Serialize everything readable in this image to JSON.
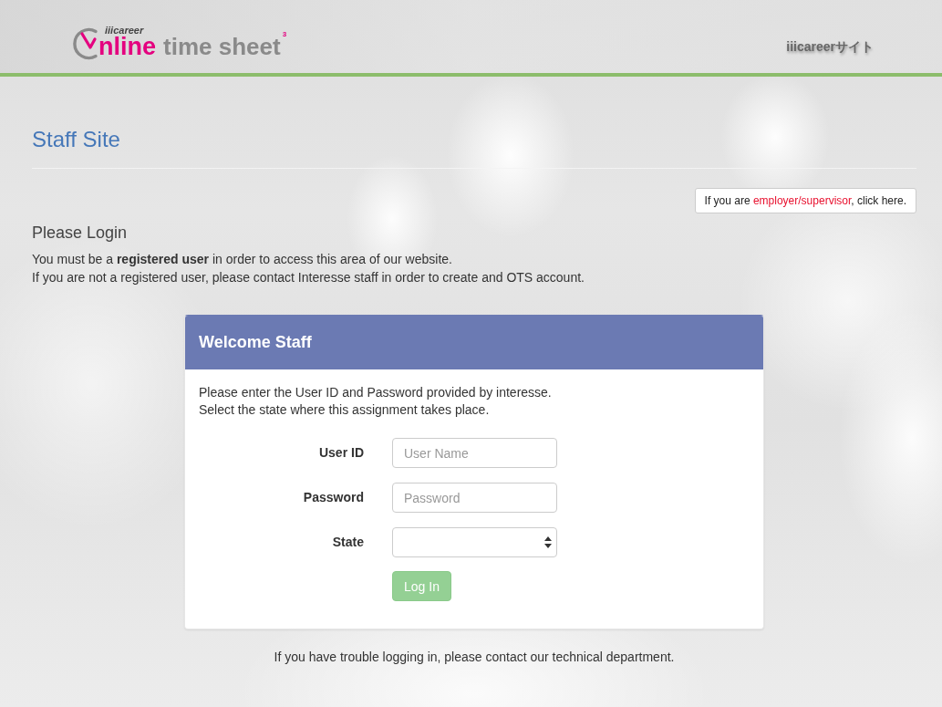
{
  "header": {
    "logo": {
      "tagline": "iiicareer",
      "wordmark_1": "nline",
      "wordmark_2": "time sheet",
      "superscript": "3"
    },
    "site_link": "iiicareerサイト"
  },
  "page": {
    "title": "Staff Site",
    "employer_notice": {
      "before": "If you are",
      "link": "employer/supervisor",
      "after": ", click here."
    },
    "heading": "Please Login",
    "paragraphs": [
      "You must be a **registered user** in order to access this area of our website.",
      "If you are not a registered user, please contact Interesse staff in order to create and OTS account."
    ]
  },
  "login_panel": {
    "title": "Welcome Staff",
    "instructions": [
      "Please enter the User ID and Password provided by interesse.",
      "Select the state where this assignment takes place."
    ],
    "fields": [
      {
        "kind": "text",
        "label": "User ID",
        "placeholder": "User Name"
      },
      {
        "kind": "password",
        "label": "Password",
        "placeholder": "Password"
      },
      {
        "kind": "select",
        "label": "State"
      }
    ],
    "submit": {
      "label": "Log In",
      "disabled": true
    }
  },
  "footer_note": "If you have trouble logging in, please contact our technical department."
}
